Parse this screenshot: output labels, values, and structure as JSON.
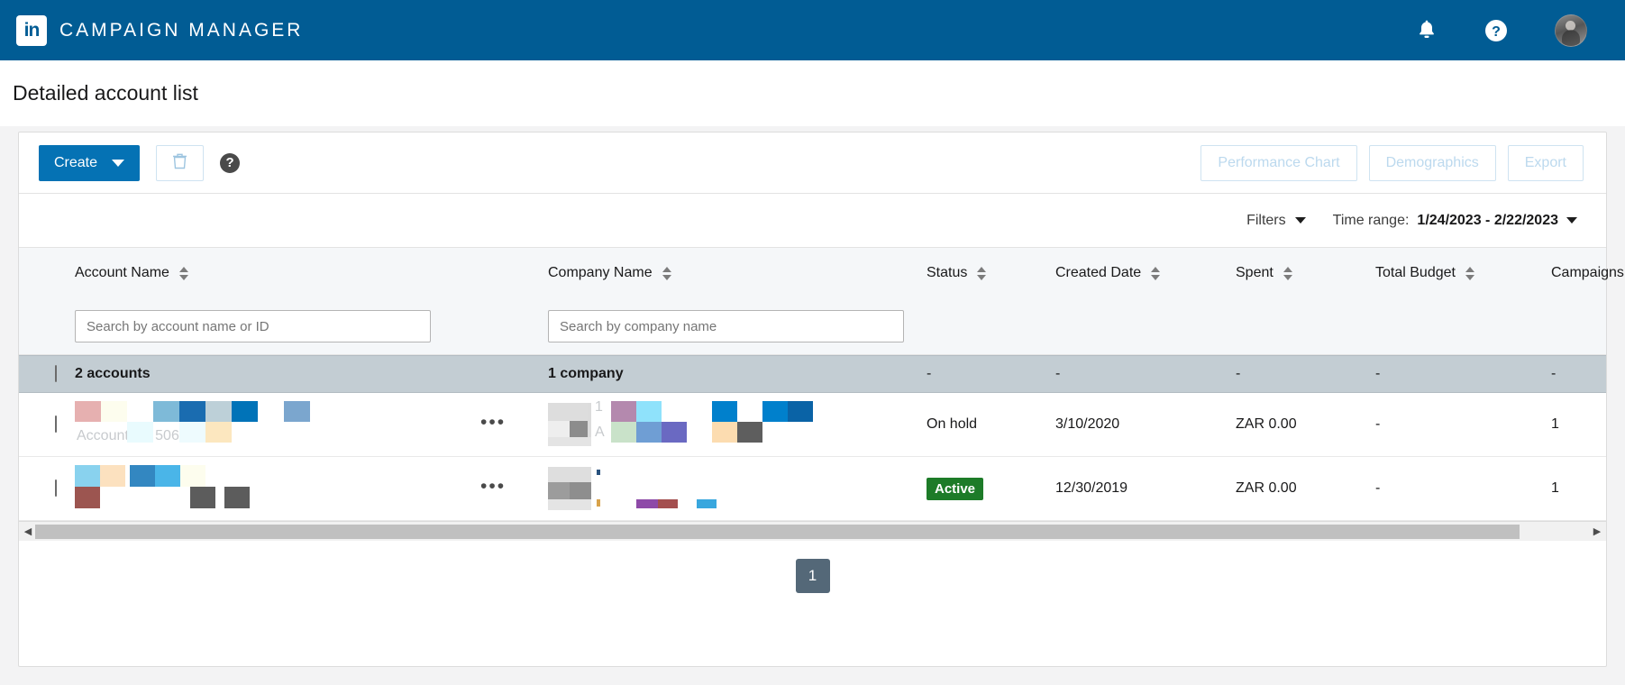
{
  "topnav": {
    "logo_text": "in",
    "brand": "CAMPAIGN MANAGER",
    "notifications_icon": "bell-icon",
    "help_icon": "question-mark-circle-icon",
    "avatar_icon": "user-avatar"
  },
  "page": {
    "title": "Detailed account list"
  },
  "toolbar": {
    "create_label": "Create",
    "delete_icon": "trash-icon",
    "help_label": "?",
    "performance_chart_label": "Performance Chart",
    "demographics_label": "Demographics",
    "export_label": "Export"
  },
  "filterbar": {
    "filters_label": "Filters",
    "time_range_label": "Time range:",
    "time_range_value": "1/24/2023 - 2/22/2023"
  },
  "table": {
    "columns": [
      {
        "key": "account",
        "label": "Account Name",
        "sortable": true
      },
      {
        "key": "company",
        "label": "Company Name",
        "sortable": true
      },
      {
        "key": "status",
        "label": "Status",
        "sortable": true
      },
      {
        "key": "created",
        "label": "Created Date",
        "sortable": true
      },
      {
        "key": "spent",
        "label": "Spent",
        "sortable": true
      },
      {
        "key": "budget",
        "label": "Total Budget",
        "sortable": true
      },
      {
        "key": "campaigns",
        "label": "Campaigns",
        "sortable": false
      }
    ],
    "search": {
      "account_placeholder": "Search by account name or ID",
      "account_value": "",
      "company_placeholder": "Search by company name",
      "company_value": ""
    },
    "summary": {
      "accounts": "2 accounts",
      "company": "1 company",
      "status": "-",
      "created": "-",
      "spent": "-",
      "budget": "-",
      "campaigns": "-"
    },
    "rows": [
      {
        "account_name": "",
        "account_sub": "Account ID: 5062897",
        "company_name": "",
        "status": "On hold",
        "status_type": "text",
        "created": "3/10/2020",
        "spent": "ZAR 0.00",
        "budget": "-",
        "campaigns": "1"
      },
      {
        "account_name": "",
        "account_sub": "",
        "company_name": "",
        "status": "Active",
        "status_type": "badge",
        "created": "12/30/2019",
        "spent": "ZAR 0.00",
        "budget": "-",
        "campaigns": "1"
      }
    ]
  },
  "scrollbar": {
    "left_arrow": "◀",
    "right_arrow": "▶"
  },
  "pagination": {
    "current_page": "1"
  },
  "colors": {
    "nav_blue": "#015c94",
    "primary_blue": "#0572b4",
    "active_green": "#1d7b28",
    "summary_row": "#c3cdd3",
    "page_btn": "#546878"
  }
}
